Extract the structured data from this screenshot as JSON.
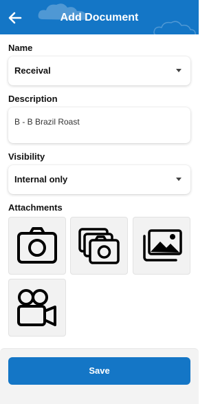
{
  "header": {
    "title": "Add Document",
    "back_icon": "arrow-left-icon",
    "background_color": "#1476c6"
  },
  "form": {
    "name": {
      "label": "Name",
      "value": "Receival"
    },
    "description": {
      "label": "Description",
      "value": "B - B Brazil Roast"
    },
    "visibility": {
      "label": "Visibility",
      "value": "Internal only"
    },
    "attachments": {
      "label": "Attachments",
      "options": [
        {
          "icon": "camera-icon"
        },
        {
          "icon": "multiple-photos-camera-icon"
        },
        {
          "icon": "image-gallery-icon"
        },
        {
          "icon": "video-camera-icon"
        }
      ]
    }
  },
  "footer": {
    "save_label": "Save",
    "accent_color": "#1476c6"
  }
}
